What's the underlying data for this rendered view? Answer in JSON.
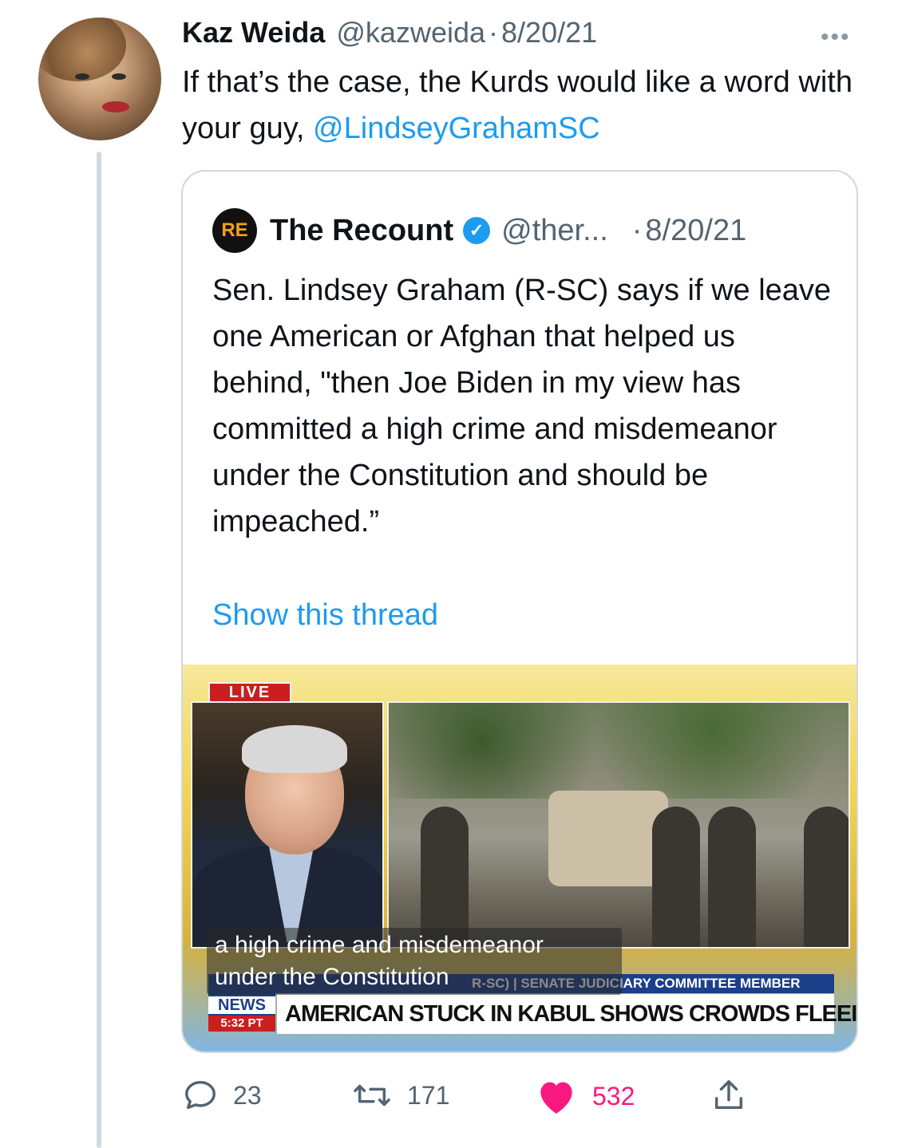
{
  "tweet": {
    "author_name": "Kaz Weida",
    "author_handle": "@kazweida",
    "separator": "·",
    "date": "8/20/21",
    "more_label": "•••",
    "text_before": "If that’s the case, the Kurds would like a word with your guy, ",
    "mention": "@LindseyGrahamSC"
  },
  "quote": {
    "logo_text": "RE",
    "name": "The Recount",
    "verified_glyph": "✓",
    "handle": "@ther...",
    "separator": "·",
    "date": "8/20/21",
    "text": "Sen. Lindsey Graham (R-SC) says if we leave one American or Afghan that helped us behind, \"then Joe Biden in my view has committed a high crime and misdemeanor under the Constitution and should be impeached.”",
    "show_thread": "Show this thread",
    "media": {
      "live_label": "LIVE",
      "caption_line1": "a high crime and misdemeanor",
      "caption_line2": "under the Constitution",
      "lower_third": "R-SC) | SENATE JUDICIARY COMMITTEE MEMBER",
      "headline": "AMERICAN STUCK IN KABUL SHOWS CROWDS FLEEING",
      "network_label": "NEWS",
      "time_label": "5:32 PT"
    }
  },
  "actions": {
    "reply_count": "23",
    "retweet_count": "171",
    "like_count": "532",
    "colors": {
      "like": "#f91880",
      "icon": "#536471",
      "link": "#1d9bf0"
    }
  }
}
